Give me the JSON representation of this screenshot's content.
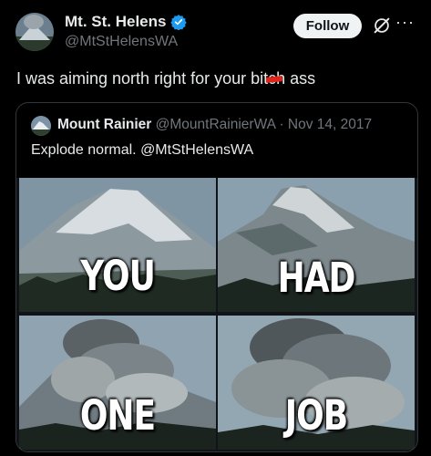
{
  "tweet": {
    "display_name": "Mt. St. Helens",
    "handle": "@MtStHelensWA",
    "follow_label": "Follow",
    "more_label": "···",
    "text_before": "I was aiming north right for your bit",
    "text_redacted": "ch",
    "text_after": " ass"
  },
  "quoted": {
    "display_name": "Mount Rainier",
    "handle": "@MountRainierWA",
    "separator": "·",
    "date": "Nov 14, 2017",
    "text": "Explode normal. @MtStHelensWA"
  },
  "meme": {
    "captions": [
      "YOU",
      "HAD",
      "ONE",
      "JOB"
    ]
  },
  "colors": {
    "background": "#000000",
    "verified": "#1d9bf0",
    "redact_mark": "#e0241b"
  },
  "icons": [
    "verified-badge-icon",
    "grok-icon",
    "more-icon"
  ]
}
